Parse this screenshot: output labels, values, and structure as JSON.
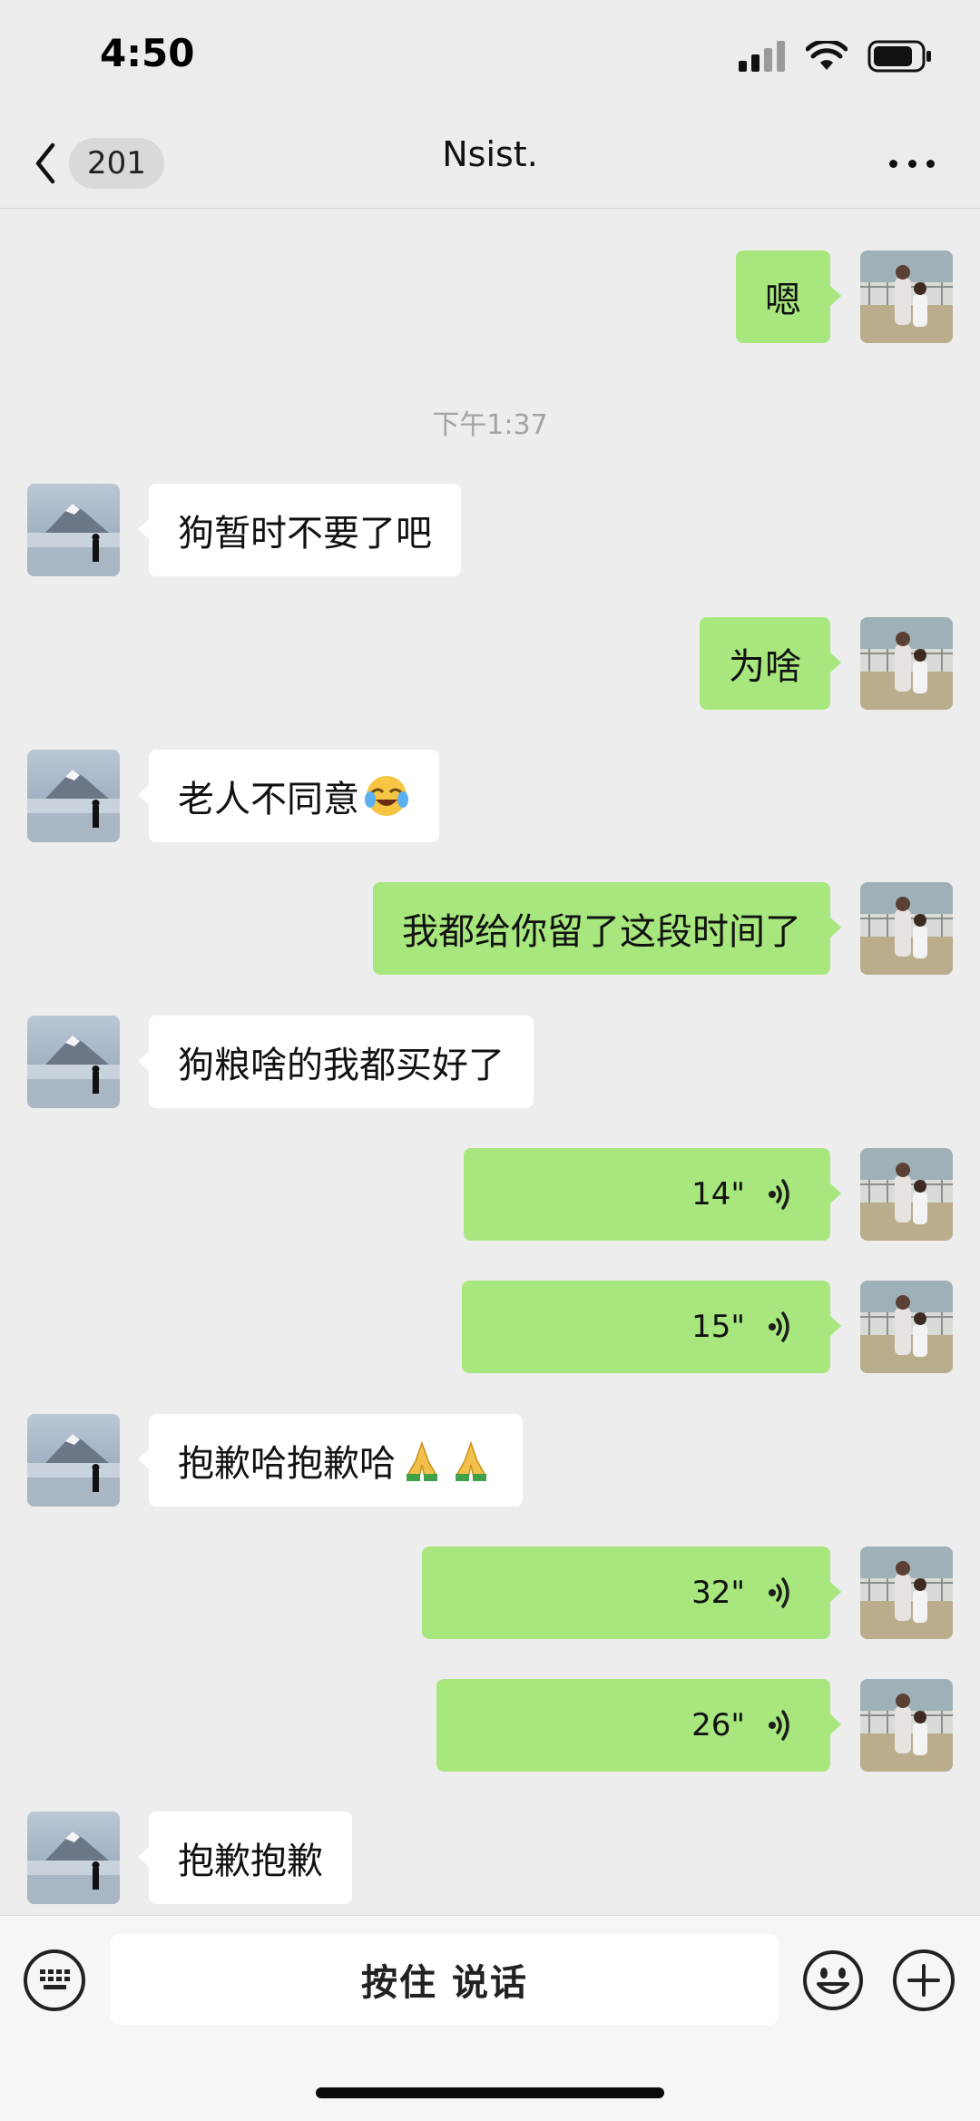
{
  "status_bar": {
    "time": "4:50"
  },
  "nav": {
    "back_count": "201",
    "title": "Nsist."
  },
  "messages": [
    {
      "side": "out",
      "type": "text",
      "text": "嗯"
    },
    {
      "type": "time",
      "text": "下午1:37"
    },
    {
      "side": "in",
      "type": "text",
      "text": "狗暂时不要了吧"
    },
    {
      "side": "out",
      "type": "text",
      "text": "为啥"
    },
    {
      "side": "in",
      "type": "text",
      "text": "老人不同意",
      "emoji": "tears-of-joy-emoji"
    },
    {
      "side": "out",
      "type": "text",
      "text": "我都给你留了这段时间了"
    },
    {
      "side": "in",
      "type": "text",
      "text": "狗粮啥的我都买好了"
    },
    {
      "side": "out",
      "type": "voice",
      "duration": "14\""
    },
    {
      "side": "out",
      "type": "voice",
      "duration": "15\""
    },
    {
      "side": "in",
      "type": "text",
      "text": "抱歉哈抱歉哈",
      "emoji": "folded-hands-emoji x2"
    },
    {
      "side": "out",
      "type": "voice",
      "duration": "32\""
    },
    {
      "side": "out",
      "type": "voice",
      "duration": "26\""
    },
    {
      "side": "in",
      "type": "text",
      "text": "抱歉抱歉"
    }
  ],
  "input_bar": {
    "hold_to_talk": "按住 说话"
  },
  "icons": {
    "back": "chevron-left-icon",
    "more": "more-dots-icon",
    "keyboard": "keyboard-icon",
    "emoji": "smiley-icon",
    "plus": "plus-icon",
    "voice": "voice-wave-icon"
  },
  "colors": {
    "outgoing_bubble": "#a8e77d",
    "incoming_bubble": "#ffffff",
    "background": "#ededed"
  }
}
